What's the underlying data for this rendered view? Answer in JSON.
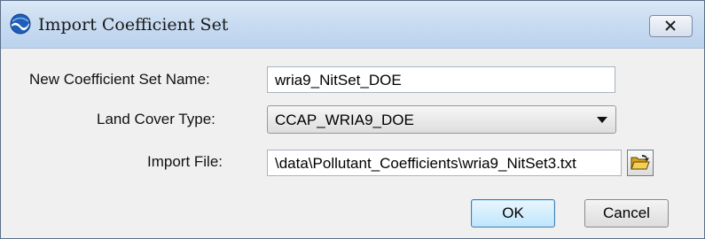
{
  "window": {
    "title": "Import Coefficient Set",
    "app_icon": "noaa-logo-icon",
    "close_icon": "close-icon"
  },
  "form": {
    "name_label": "New Coefficient Set Name:",
    "name_value": "wria9_NitSet_DOE",
    "landcover_label": "Land Cover Type:",
    "landcover_value": "CCAP_WRIA9_DOE",
    "import_label": "Import File:",
    "import_value": "\\data\\Pollutant_Coefficients\\wria9_NitSet3.txt",
    "browse_icon": "open-folder-icon"
  },
  "buttons": {
    "ok": "OK",
    "cancel": "Cancel"
  },
  "colors": {
    "titlebar": "#c9dcf1",
    "dialog_bg": "#f0f0f0",
    "default_button": "#bee6fd"
  }
}
